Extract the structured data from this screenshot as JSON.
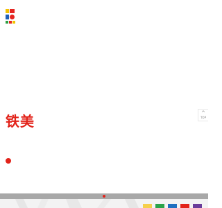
{
  "brand": {
    "title": "铁美",
    "logo_icon": "tiemei-logo-icon",
    "colors": {
      "red": "#e2231a",
      "yellow": "#f2c200",
      "blue": "#1f5fb8",
      "green": "#2f9e44"
    }
  },
  "back_to_top": {
    "icon": "arrow-up-icon",
    "glyph": "^",
    "label": "TOP"
  },
  "carousel": {
    "active_index": 1,
    "indicator_color": "#e2231a"
  },
  "footer": {
    "swatch_colors": [
      "#f5cf4b",
      "#2aa34a",
      "#1e6fc0",
      "#e2231a",
      "#6a3d9a"
    ]
  }
}
